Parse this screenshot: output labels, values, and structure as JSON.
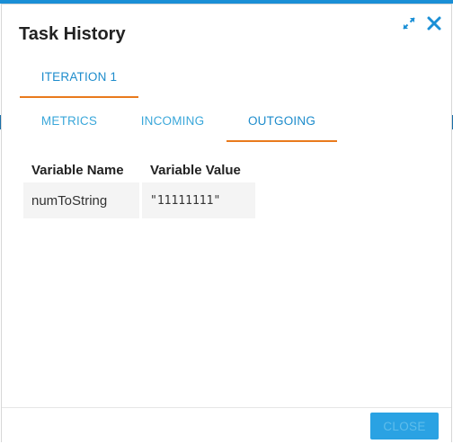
{
  "dialog": {
    "title": "Task History",
    "icons": {
      "expand": "expand-icon",
      "close": "close-icon"
    }
  },
  "tabs": [
    {
      "label": "ITERATION 1",
      "active": true
    }
  ],
  "sub_tabs": [
    {
      "label": "METRICS",
      "active": false
    },
    {
      "label": "INCOMING",
      "active": false
    },
    {
      "label": "OUTGOING",
      "active": true
    }
  ],
  "variables": {
    "columns": [
      "Variable Name",
      "Variable Value"
    ],
    "rows": [
      {
        "name": "numToString",
        "value": "\"11111111\""
      }
    ]
  },
  "footer": {
    "close_label": "CLOSE"
  },
  "colors": {
    "accent": "#2aa2e3",
    "tab_text": "#3aa7da",
    "tab_underline": "#e97a1d",
    "top_strip": "#1a8fd6"
  }
}
